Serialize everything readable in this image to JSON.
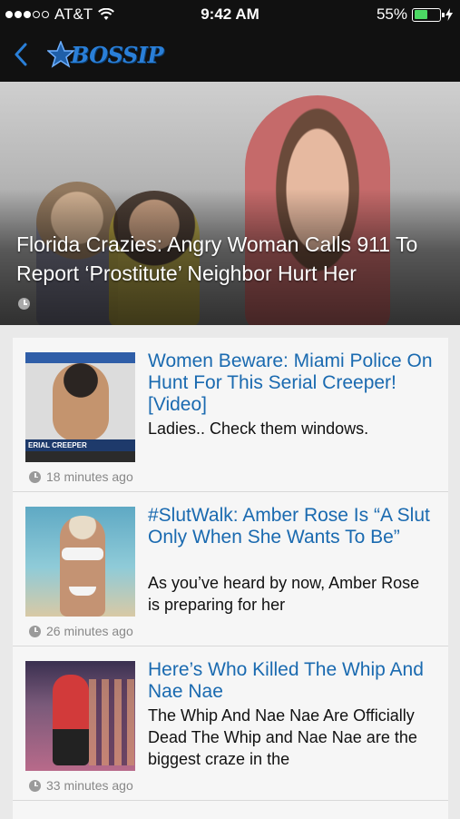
{
  "status_bar": {
    "carrier": "AT&T",
    "time": "9:42 AM",
    "battery_percent": "55%",
    "battery_level": 0.55,
    "signal_bars_filled": 3,
    "signal_bars_total": 5
  },
  "nav": {
    "back_icon": "chevron-left-icon",
    "logo_text": "BOSSIP",
    "accent_color": "#2a7fd8"
  },
  "hero": {
    "title": "Florida Crazies: Angry Woman Calls 911 To Report ‘Prostitute’ Neighbor Hurt Her"
  },
  "articles": [
    {
      "headline": "Women Beware: Miami Police On Hunt For This Serial Creeper! [Video]",
      "excerpt": "Ladies.. Check them windows.",
      "time": "18 minutes ago",
      "thumb_caption": "ERIAL CREEPER"
    },
    {
      "headline": "#SlutWalk: Amber Rose Is “A Slut Only When She Wants To Be”",
      "excerpt": "As you’ve heard by now, Amber Rose is preparing for her",
      "time": "26 minutes ago"
    },
    {
      "headline": "Here’s Who Killed The Whip And Nae Nae",
      "excerpt": "The Whip And Nae Nae Are Officially Dead The Whip and Nae Nae are the biggest craze in the",
      "time": "33 minutes ago"
    }
  ]
}
